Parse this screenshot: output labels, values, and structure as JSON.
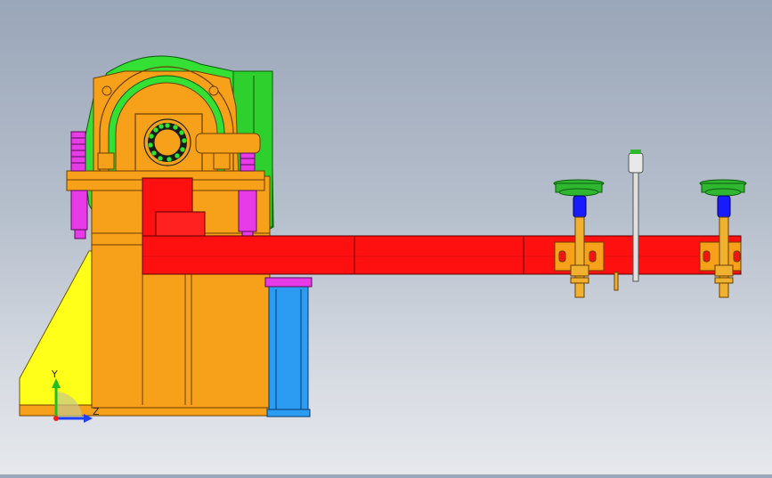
{
  "viewport": {
    "background_top": "#9aa6b9",
    "background_bottom": "#e6e8ec"
  },
  "model_colors": {
    "arm": "#ff1010",
    "frame": "#f7a11a",
    "gearbox": "#33e033",
    "base_plate": "#ffff1a",
    "spring": "#e83be8",
    "column": "#2b9cf2",
    "suction_cup": "#2fb82f",
    "cylinder_tip": "#1a1aff",
    "rod": "#f0b030"
  },
  "triad": {
    "y_label": "Y",
    "z_label": "Z",
    "y_color": "#1fbf1f",
    "z_color": "#1f3fff",
    "x_color": "#ff1a1a"
  }
}
